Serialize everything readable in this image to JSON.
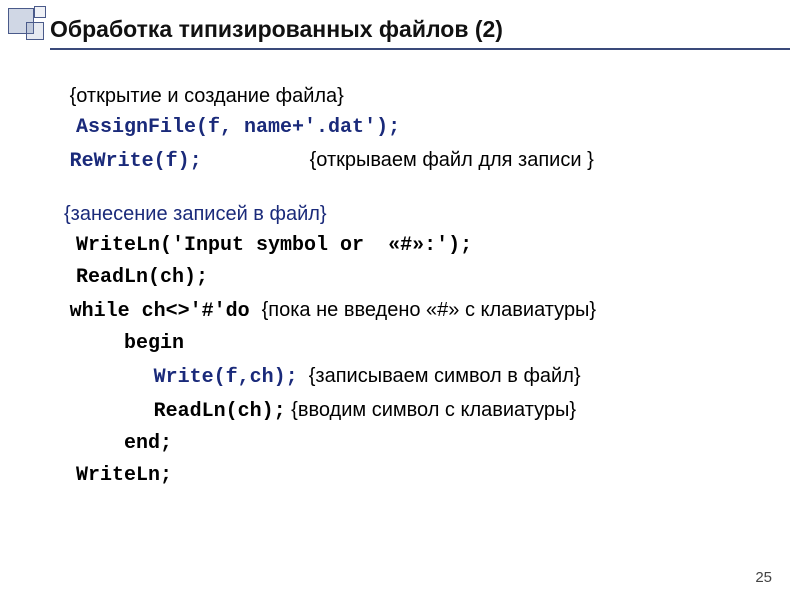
{
  "title": "Обработка типизированных файлов (2)",
  "page_number": "25",
  "lines": {
    "c1": "{открытие и создание файла}",
    "l1": "AssignFile(f, name+'.dat');",
    "l2a": "ReWrite(f);",
    "l2b": "{открываем файл для записи }",
    "c2": "{занесение записей в файл}",
    "l3": "WriteLn('Input symbol or  «#»:');",
    "l4": "ReadLn(ch);",
    "l5a": "while ch<>'#'do ",
    "l5b": "{пока не введено «#» с клавиатуры}",
    "l6": "    begin",
    "l7a": "       Write(f,ch);",
    "l7b": "  {записываем символ в файл}",
    "l8a": "       ReadLn(ch);",
    "l8b": " {вводим символ с клавиатуры}",
    "l9": "    end;",
    "l10": "WriteLn;"
  }
}
